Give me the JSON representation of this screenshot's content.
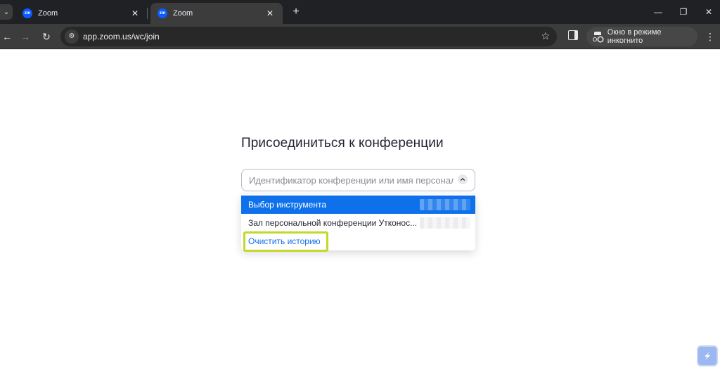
{
  "browser": {
    "tabs": [
      {
        "title": "Zoom",
        "favicon": "zm",
        "active": false
      },
      {
        "title": "Zoom",
        "favicon": "zm",
        "active": true
      }
    ],
    "url": "app.zoom.us/wc/join",
    "incognito_label": "Окно в режиме инкогнито"
  },
  "page": {
    "title": "Присоединиться к конференции",
    "input_placeholder": "Идентификатор конференции или имя персонального",
    "dropdown": {
      "items": [
        {
          "label": "Выбор инструмента"
        },
        {
          "label": "Зал персональной конференции Утконос..."
        }
      ],
      "clear_history": "Очистить историю"
    }
  },
  "colors": {
    "accent": "#0e71eb",
    "highlight": "#c3d82c",
    "chrome_dark": "#202124",
    "chrome_toolbar": "#3c3c3c"
  }
}
